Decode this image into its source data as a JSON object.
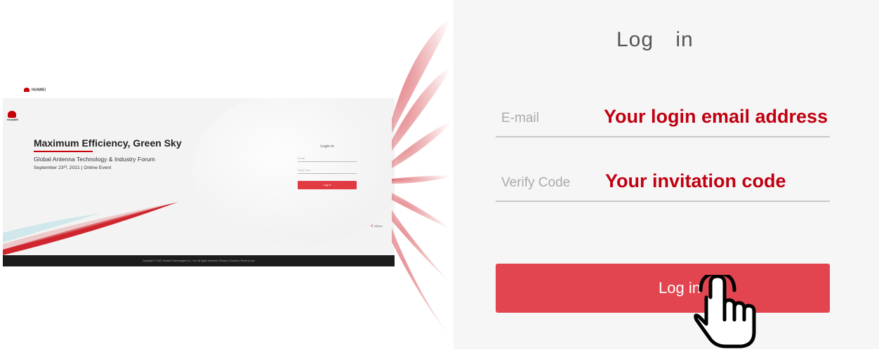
{
  "thumbnail": {
    "brand": "HUAWEI",
    "logo_text": "HUAWEI",
    "hero_title_part1": "Maximum",
    "hero_title_part2": " Efficiency, Green Sky",
    "hero_subtitle": "Global Antenna Technology & Industry Forum",
    "hero_date": "September 23ʳᵈ, 2021 | Online Event",
    "login_title": "Login in",
    "email_placeholder": "E-mail",
    "code_placeholder": "Verify Code",
    "login_button": "Log in",
    "share_label": "Share",
    "footer": "Copyright © 2021 Huawei Technologies Co., Ltd. All rights reserved.   Privacy  |  Cookies  |  Terms of use"
  },
  "zoom": {
    "title": "Log in",
    "email_placeholder": "E-mail",
    "email_hint": "Your login email address",
    "code_placeholder": "Verify Code",
    "code_hint": "Your invitation code",
    "login_button": "Log in"
  },
  "colors": {
    "accent": "#c7000b",
    "button": "#e24550",
    "hint": "#c00010"
  },
  "icons": [
    "huawei-logo-icon",
    "share-icon",
    "pointing-hand-icon"
  ]
}
